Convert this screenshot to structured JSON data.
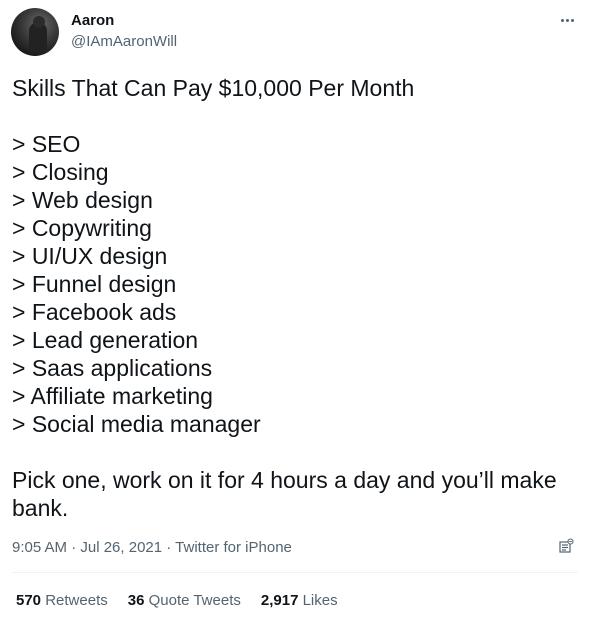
{
  "author": {
    "name": "Aaron",
    "handle": "@IAmAaronWill"
  },
  "tweet": {
    "title": "Skills That Can Pay $10,000 Per Month",
    "skills": [
      "> SEO",
      "> Closing",
      "> Web design",
      "> Copywriting",
      "> UI/UX design",
      "> Funnel design",
      "> Facebook ads",
      "> Lead generation",
      "> Saas applications",
      "> Affiliate marketing",
      "> Social media manager"
    ],
    "closing": "Pick one, work on it for 4 hours a day and you’ll make bank.",
    "timestamp": "9:05 AM · Jul 26, 2021 · Twitter for iPhone"
  },
  "stats": {
    "retweets_count": "570",
    "retweets_label": "Retweets",
    "quotes_count": "36",
    "quotes_label": "Quote Tweets",
    "likes_count": "2,917",
    "likes_label": "Likes"
  },
  "icons": {
    "avatar": "profile-photo",
    "more": "more-options-icon",
    "analytics": "analytics-icon"
  },
  "colors": {
    "primary_text": "#0f1419",
    "secondary_text": "#536471",
    "divider": "#eff3f4"
  }
}
